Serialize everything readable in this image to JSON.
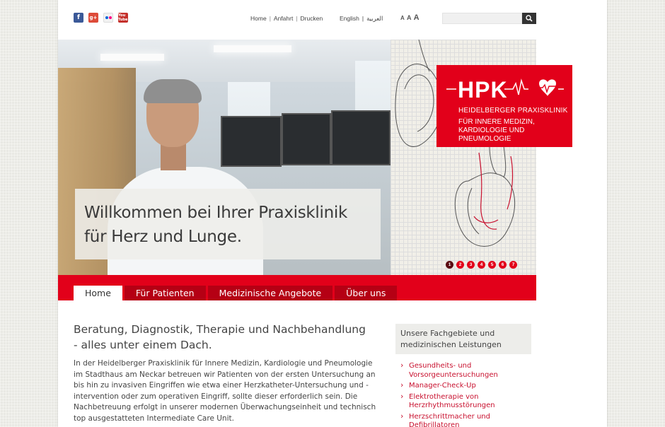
{
  "social": [
    {
      "name": "facebook-icon",
      "glyph": "f"
    },
    {
      "name": "google-plus-icon",
      "glyph": "g+"
    },
    {
      "name": "flickr-icon",
      "glyph": ""
    },
    {
      "name": "youtube-icon",
      "glyph": "You Tube"
    }
  ],
  "topnav": {
    "home": "Home",
    "anfahrt": "Anfahrt",
    "drucken": "Drucken",
    "sep": "|"
  },
  "langs": {
    "english": "English",
    "arabic": "العربية",
    "sep": "|"
  },
  "fontsize": {
    "a1": "A",
    "a2": "A",
    "a3": "A"
  },
  "search": {
    "placeholder": "",
    "value": ""
  },
  "hero": {
    "welcome_line1": "Willkommen bei Ihrer Praxisklinik",
    "welcome_line2": "für Herz und Lunge.",
    "slides": [
      "1",
      "2",
      "3",
      "4",
      "5",
      "6",
      "7"
    ],
    "active_slide": 1
  },
  "logo": {
    "hpk": "HPK",
    "line1": "HEIDELBERGER PRAXISKLINIK",
    "line2": "FÜR INNERE MEDIZIN, KARDIOLOGIE UND PNEUMOLOGIE"
  },
  "mainnav": {
    "items": [
      "Home",
      "Für Patienten",
      "Medizinische Angebote",
      "Über uns"
    ],
    "active": 0
  },
  "content": {
    "headline": "Beratung, Diagnostik, Therapie und Nachbehandlung - alles unter einem Dach.",
    "body": "In der Heidelberger Praxisklinik für Innere Medizin, Kardiologie und Pneumologie im Stadthaus am Neckar betreuen wir Patienten von der ersten Untersuchung an bis hin zu invasiven Eingriffen wie etwa einer Herzkatheter-Untersuchung und -intervention oder zum operativen Eingriff, sollte dieser erforderlich sein. Die Nachbetreuung erfolgt in unserer modernen Überwachungseinheit und technisch top ausgestatteten Intermediate Care Unit."
  },
  "sidebox": {
    "title": "Unsere Fachgebiete und medizinischen Leistungen",
    "links": [
      "Gesundheits- und Vorsorgeuntersuchungen",
      "Manager-Check-Up",
      "Elektrotherapie von Herzrhythmusstörungen",
      "Herzschrittmacher und Defibrillatoren"
    ]
  },
  "colors": {
    "brand_red": "#e2001a",
    "nav_dark_red": "#b50014",
    "link_red": "#c8102e"
  }
}
